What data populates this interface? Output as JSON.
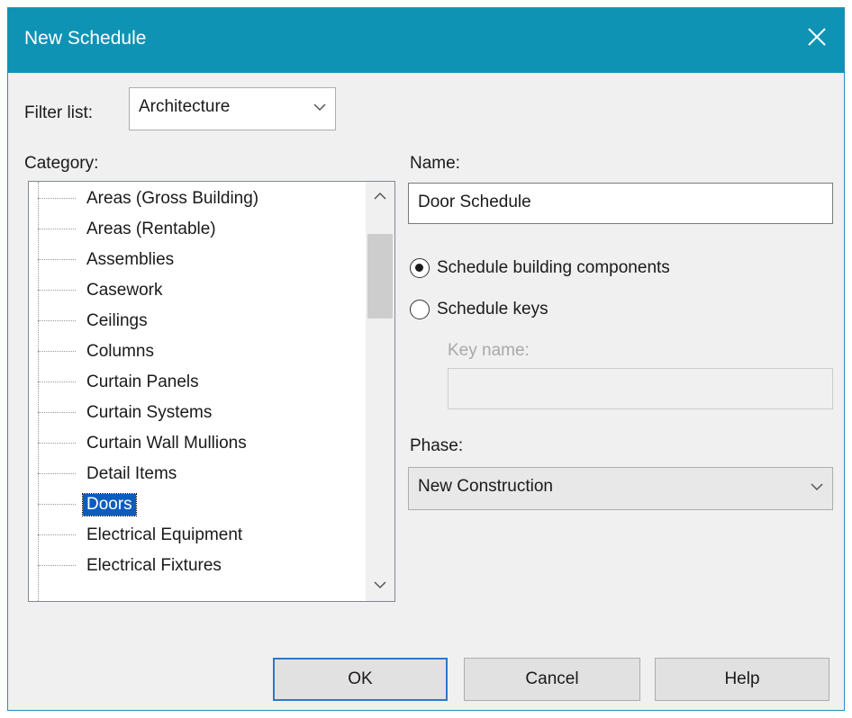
{
  "window": {
    "title": "New Schedule"
  },
  "filter": {
    "label": "Filter list:",
    "selected": "Architecture"
  },
  "category": {
    "label": "Category:",
    "items": [
      "Areas (Gross Building)",
      "Areas (Rentable)",
      "Assemblies",
      "Casework",
      "Ceilings",
      "Columns",
      "Curtain Panels",
      "Curtain Systems",
      "Curtain Wall Mullions",
      "Detail Items",
      "Doors",
      "Electrical Equipment",
      "Electrical Fixtures"
    ],
    "selected": "Doors"
  },
  "name": {
    "label": "Name:",
    "value": "Door Schedule"
  },
  "schedule_type": {
    "option_components": "Schedule building components",
    "option_keys": "Schedule keys",
    "selected": "Schedule building components"
  },
  "key_name": {
    "label": "Key name:",
    "value": ""
  },
  "phase": {
    "label": "Phase:",
    "selected": "New Construction"
  },
  "buttons": {
    "ok": "OK",
    "cancel": "Cancel",
    "help": "Help"
  },
  "colors": {
    "titlebar": "#0e93b5",
    "selection": "#0a5dbd",
    "dialog_bg": "#f0f0f0"
  },
  "icons": {
    "close": "close-icon",
    "dropdown": "chevron-down-icon",
    "scroll_up": "chevron-up-icon",
    "scroll_down": "chevron-down-icon"
  }
}
